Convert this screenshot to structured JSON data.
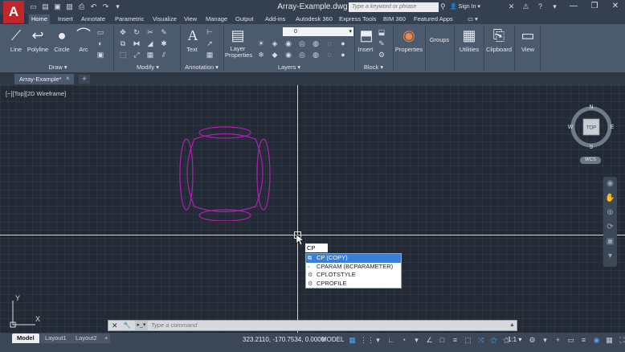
{
  "app": {
    "logo_letter": "A",
    "title": "Array-Example.dwg"
  },
  "quick_access": [
    "new-icon",
    "open-icon",
    "save-icon",
    "saveas-icon",
    "print-icon",
    "undo-icon",
    "redo-icon",
    "dropdown-icon"
  ],
  "search": {
    "placeholder": "Type a keyword or phrase",
    "sign_in": "Sign In"
  },
  "ribbon_tabs": [
    {
      "label": "Home",
      "active": true
    },
    {
      "label": "Insert"
    },
    {
      "label": "Annotate"
    },
    {
      "label": "Parametric"
    },
    {
      "label": "Visualize"
    },
    {
      "label": "View"
    },
    {
      "label": "Manage"
    },
    {
      "label": "Output"
    },
    {
      "label": "Add-ins"
    },
    {
      "label": "Autodesk 360"
    },
    {
      "label": "Express Tools"
    },
    {
      "label": "BIM 360"
    },
    {
      "label": "Featured Apps"
    }
  ],
  "draw_panel": {
    "title": "Draw ▾",
    "tools": [
      "Line",
      "Polyline",
      "Circle",
      "Arc"
    ]
  },
  "modify_panel": {
    "title": "Modify ▾"
  },
  "annotation_panel": {
    "title": "Annotation ▾",
    "text_label": "Text"
  },
  "layers_panel": {
    "title": "Layers ▾",
    "layer_properties": "Layer Properties",
    "current_layer": "0"
  },
  "block_panel": {
    "title": "Block ▾",
    "insert_label": "Insert"
  },
  "properties_tool": {
    "label": "Properties"
  },
  "groups_tool": {
    "label": "Groups"
  },
  "utilities_tool": {
    "label": "Utilities"
  },
  "clipboard_tool": {
    "label": "Clipboard"
  },
  "view_tool": {
    "label": "View"
  },
  "document_tab": {
    "label": "Array-Example*"
  },
  "viewport_label": "[−][Top][2D Wireframe]",
  "viewcube": {
    "n": "N",
    "s": "S",
    "e": "E",
    "w": "W",
    "face": "TOP",
    "wcs": "WCS"
  },
  "ucs": {
    "y": "Y",
    "x": "X"
  },
  "command": {
    "typed": "CP",
    "placeholder": "Type a command"
  },
  "autocomplete": [
    {
      "label": "CP (COPY)",
      "selected": true,
      "icon": "copy-icon"
    },
    {
      "label": "CPARAM (BCPARAMETER)",
      "icon": "parameter-icon"
    },
    {
      "label": "CPLOTSTYLE",
      "icon": "system-variable-icon"
    },
    {
      "label": "CPROFILE",
      "icon": "system-variable-icon"
    }
  ],
  "layout_tabs": [
    "Model",
    "Layout1",
    "Layout2"
  ],
  "status": {
    "coords": "323.2110, -170.7534, 0.0000",
    "model": "MODEL",
    "annotation_scale": "1:1 ▾"
  },
  "colors": {
    "accent": "#c0262b",
    "drawing": "#b11fb1",
    "ribbon": "#4b5a6d",
    "canvas": "#222a36"
  }
}
